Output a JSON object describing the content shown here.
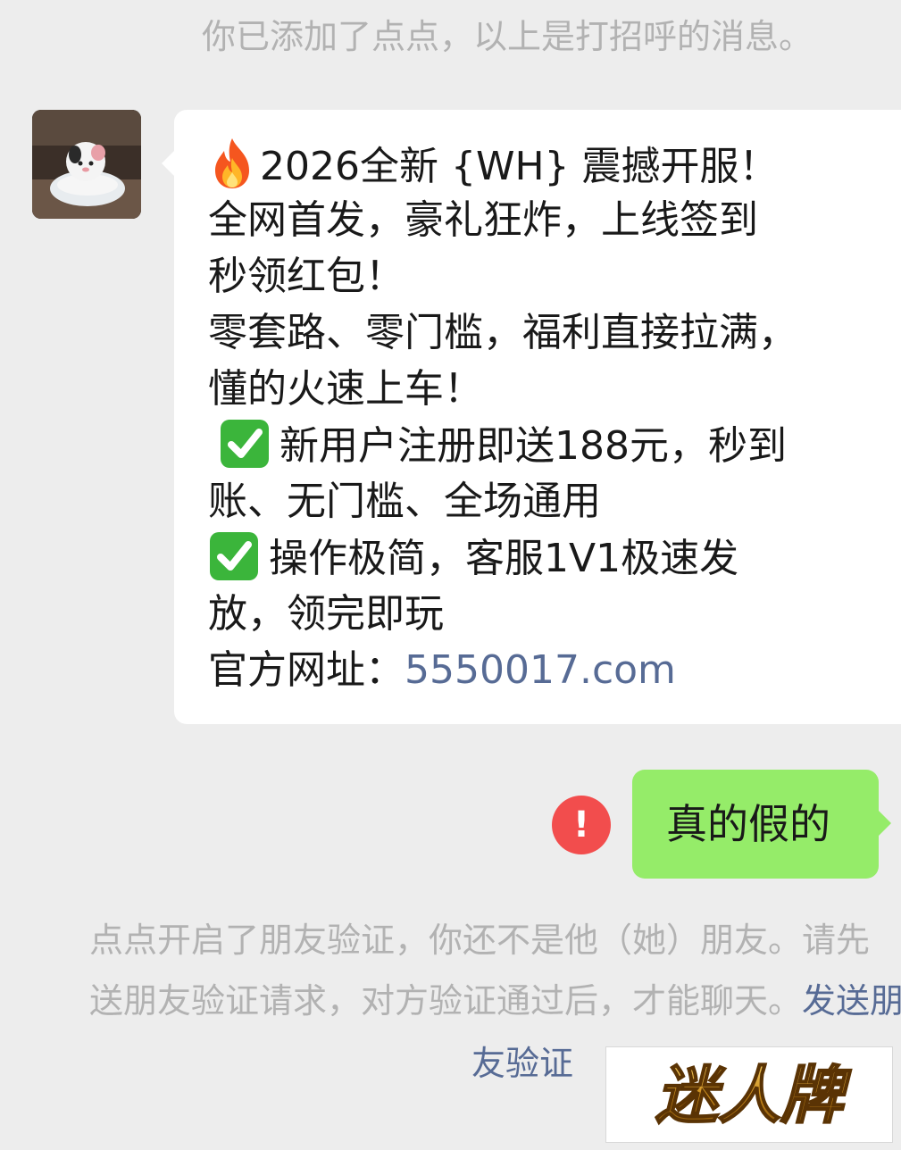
{
  "system_top": "你已添加了点点，以上是打招呼的消息。",
  "incoming_message": {
    "sender_avatar_icon": "avatar-photo",
    "lines": [
      "2026全新 {WH} 震撼开服！",
      "全网首发，豪礼狂炸，上线签到",
      "秒领红包！",
      "零套路、零门槛，福利直接拉满，",
      "懂的火速上车！",
      "新用户注册即送188元，秒到",
      "账、无门槛、全场通用",
      "操作极简，客服1V1极速发",
      "放，领完即玩",
      "官方网址："
    ],
    "link": "5550017.com"
  },
  "outgoing_message": {
    "text": "真的假的",
    "status_icon": "!"
  },
  "verify_notice": {
    "line1": "点点开启了朋友验证，你还不是他（她）朋友。请先",
    "line2": "送朋友验证请求，对方验证通过后，才能聊天。",
    "link_part1": "发送朋",
    "link_part2": "友验证"
  },
  "watermark": {
    "text": "迷人牌"
  },
  "colors": {
    "background": "#ededed",
    "bubble_incoming": "#ffffff",
    "bubble_outgoing": "#95ec69",
    "link": "#576b95",
    "system_text": "#b2b2b2",
    "error": "#f24d4d"
  }
}
